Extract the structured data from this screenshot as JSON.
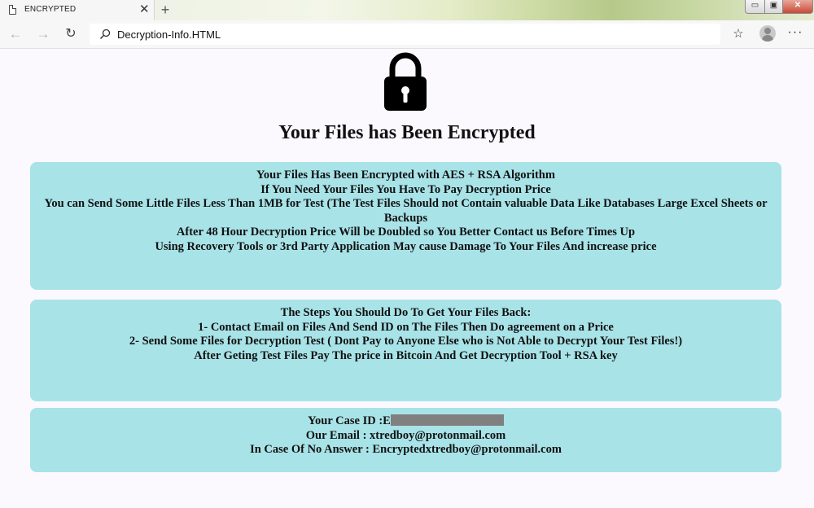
{
  "browser": {
    "tab_title": "ENCRYPTED",
    "tab_close_glyph": "✕",
    "new_tab_glyph": "+",
    "url": "Decryption-Info.HTML",
    "window_controls": {
      "minimize": "▭",
      "maximize": "▣",
      "close": "✕"
    },
    "icons": [
      "back-arrow-icon",
      "forward-arrow-icon",
      "reload-icon",
      "search-icon",
      "favorites-icon",
      "profile-icon",
      "more-icon",
      "page-icon",
      "lock-icon"
    ]
  },
  "page": {
    "title": "Your Files has Been Encrypted",
    "box1": {
      "lines": [
        "Your Files Has Been Encrypted with AES + RSA Algorithm",
        "If You Need Your Files You Have To Pay Decryption Price",
        "You can Send Some Little Files Less Than 1MB for Test (The Test Files Should not Contain valuable Data Like Databases Large Excel Sheets or Backups",
        "After 48 Hour Decryption Price Will be Doubled so You Better Contact us Before Times Up",
        "Using Recovery Tools or 3rd Party Application May cause Damage To Your Files And increase price"
      ]
    },
    "box2": {
      "lines": [
        "The Steps You Should Do To Get Your Files Back:",
        "1- Contact Email on Files And Send ID on The Files Then Do agreement on a Price",
        "2- Send Some Files for Decryption Test ( Dont Pay to Anyone Else who is Not Able to Decrypt Your Test Files!)",
        "After Geting Test Files Pay The price in Bitcoin And Get Decryption Tool + RSA key"
      ]
    },
    "box3": {
      "case_id_label": "Your Case ID :E",
      "email_line": "Our Email : xtredboy@protonmail.com",
      "no_answer_line": "In Case Of No Answer : Encryptedxtredboy@protonmail.com"
    },
    "colors": {
      "page_bg": "#fbf9fe",
      "box_bg": "#a8e3e8",
      "text": "#111111"
    }
  }
}
